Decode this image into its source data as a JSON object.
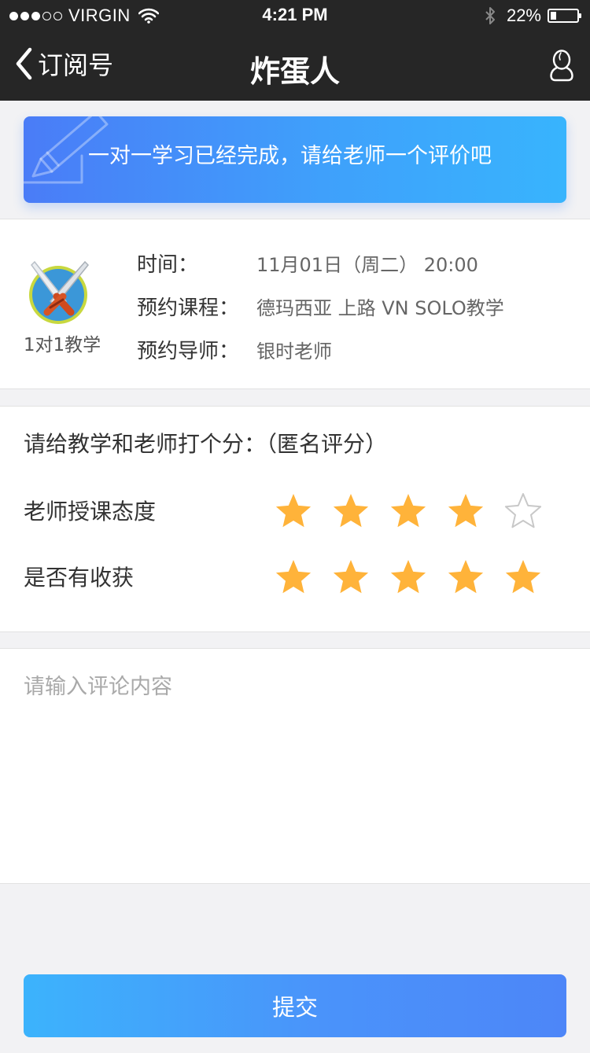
{
  "status_bar": {
    "carrier": "VIRGIN",
    "time": "4:21 PM",
    "battery": "22%",
    "battery_level": 0.22
  },
  "nav": {
    "back_label": "订阅号",
    "title": "炸蛋人",
    "back_icon": "chevron-left-icon",
    "user_icon": "user-icon"
  },
  "banner": {
    "text": "一对一学习已经完成，请给老师一个评价吧",
    "icon": "pencil-icon"
  },
  "course": {
    "icon": "crossed-swords-icon",
    "icon_label": "1对1教学",
    "rows": [
      {
        "label": "时间：",
        "value": "11月01日（周二） 20:00"
      },
      {
        "label": "预约课程：",
        "value": "德玛西亚 上路 VN  SOLO教学"
      },
      {
        "label": "预约导师：",
        "value": "银时老师"
      }
    ]
  },
  "rating": {
    "title": "请给教学和老师打个分：（匿名评分）",
    "max": 5,
    "items": [
      {
        "label": "老师授课态度",
        "score": 4
      },
      {
        "label": "是否有收获",
        "score": 5
      }
    ]
  },
  "comment": {
    "placeholder": "请输入评论内容",
    "value": ""
  },
  "submit_label": "提交",
  "colors": {
    "bar_bg": "#262626",
    "star_filled": "#ffb33a",
    "star_empty_stroke": "#c8c8c8",
    "banner_gradient_start": "#4a7cf7",
    "banner_gradient_end": "#38b4fd",
    "button_gradient_start": "#3cb3fc",
    "button_gradient_end": "#4d86f8"
  }
}
